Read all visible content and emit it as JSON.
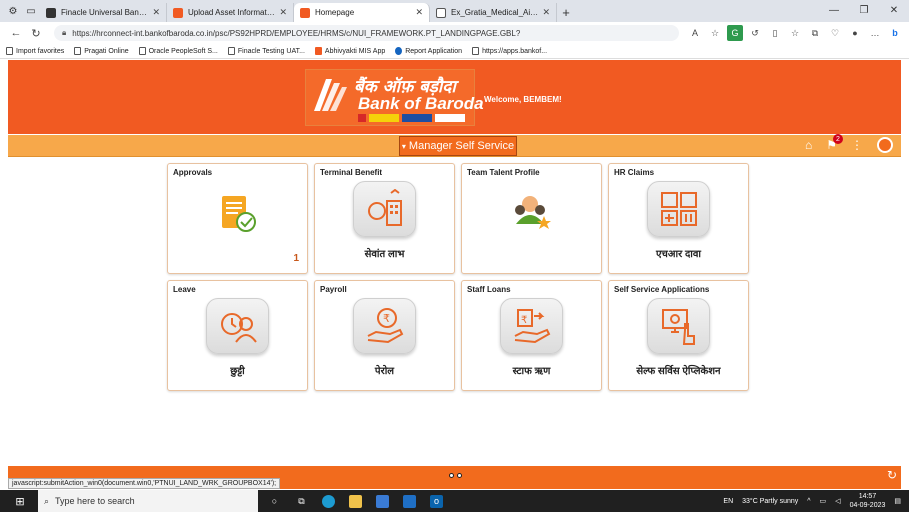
{
  "browser": {
    "tabs": [
      {
        "title": "Finacle Universal Banking Solutio",
        "color": "#333333"
      },
      {
        "title": "Upload Asset Information",
        "color": "#f15a22"
      },
      {
        "title": "Homepage",
        "color": "#f15a22",
        "active": true
      },
      {
        "title": "Ex_Gratia_Medical_Aid_Scheme.p",
        "color": "#555555"
      }
    ],
    "new_tab": "+",
    "url": "https://hrconnect-int.bankofbaroda.co.in/psc/PS92HPRD/EMPLOYEE/HRMS/c/NUI_FRAMEWORK.PT_LANDINGPAGE.GBL?",
    "favorites": [
      {
        "label": "Import favorites"
      },
      {
        "label": "Pragati Online"
      },
      {
        "label": "Oracle PeopleSoft S..."
      },
      {
        "label": "Finacle Testing UAT..."
      },
      {
        "label": "Abhivyakti MIS App"
      },
      {
        "label": "Report Application"
      },
      {
        "label": "https://apps.bankof..."
      }
    ]
  },
  "header": {
    "logo_hindi": "बैंक ऑफ़ बड़ौदा",
    "logo_english": "Bank of Baroda",
    "welcome": "Welcome, BEMBEM!",
    "brand_color": "#f15a22"
  },
  "menu": {
    "selector_label": "Manager Self Service",
    "notification_count": "2"
  },
  "tiles": [
    {
      "title": "Approvals",
      "label": "",
      "count": "1",
      "icon": "approvals-icon"
    },
    {
      "title": "Terminal Benefit",
      "label": "सेवांत लाभ",
      "count": "",
      "icon": "terminal-benefit-icon"
    },
    {
      "title": "Team Talent Profile",
      "label": "",
      "count": "",
      "icon": "team-talent-icon"
    },
    {
      "title": "HR Claims",
      "label": "एचआर दावा",
      "count": "",
      "icon": "hr-claims-icon"
    },
    {
      "title": "Leave",
      "label": "छुट्टी",
      "count": "",
      "icon": "leave-icon"
    },
    {
      "title": "Payroll",
      "label": "पेरोल",
      "count": "",
      "icon": "payroll-icon"
    },
    {
      "title": "Staff Loans",
      "label": "स्टाफ ऋण",
      "count": "",
      "icon": "staff-loans-icon"
    },
    {
      "title": "Self Service Applications",
      "label": "सेल्फ सर्विस ऐप्लिकेशन",
      "count": "",
      "icon": "self-service-icon"
    }
  ],
  "status": {
    "js_text": "javascript:submitAction_win0(document.win0,'PTNUI_LAND_WRK_GROUPBOX14');"
  },
  "taskbar": {
    "search_placeholder": "Type here to search",
    "lang": "EN",
    "weather": "33°C  Partly sunny",
    "time": "14:57",
    "date": "04-09-2023"
  }
}
